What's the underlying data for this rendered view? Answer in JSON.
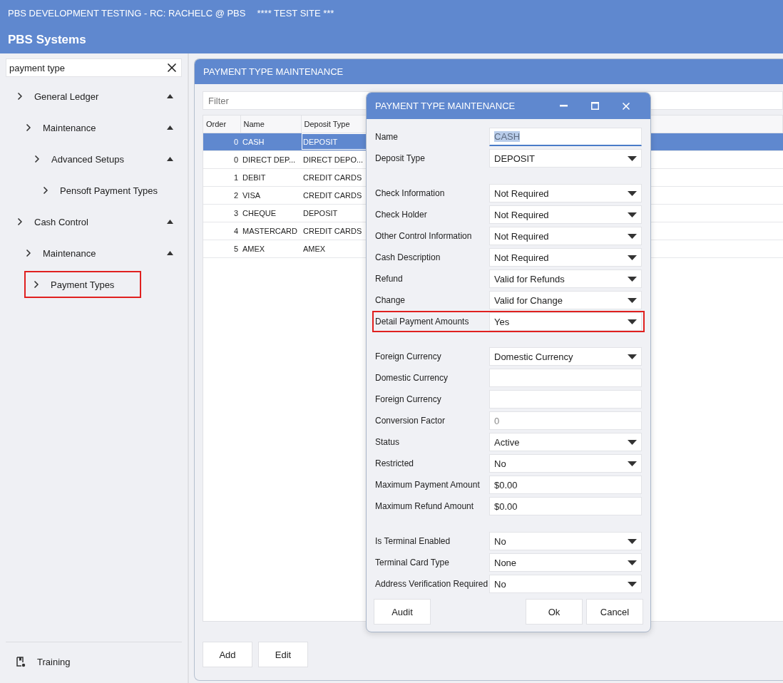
{
  "app": {
    "title": "PBS DEVELOPMENT TESTING - RC: RACHELC @ PBS",
    "site_note": "**** TEST SITE ***",
    "name": "PBS Systems"
  },
  "sidebar": {
    "search": {
      "value": "payment type"
    },
    "tree": [
      {
        "label": "General Ledger",
        "expanded": true,
        "highlighted": false,
        "children": [
          {
            "label": "Maintenance",
            "expanded": true,
            "highlighted": false,
            "children": [
              {
                "label": "Advanced Setups",
                "expanded": true,
                "highlighted": false,
                "children": [
                  {
                    "label": "Pensoft Payment Types",
                    "highlighted": false
                  }
                ]
              }
            ]
          }
        ]
      },
      {
        "label": "Cash Control",
        "expanded": true,
        "highlighted": false,
        "children": [
          {
            "label": "Maintenance",
            "expanded": true,
            "highlighted": false,
            "children": [
              {
                "label": "Payment Types",
                "highlighted": true
              }
            ]
          }
        ]
      }
    ],
    "footer_item": {
      "label": "Training"
    }
  },
  "panel": {
    "title": "PAYMENT TYPE MAINTENANCE",
    "filter": {
      "placeholder": "Filter"
    },
    "table": {
      "columns": [
        "Order",
        "Name",
        "Deposit Type"
      ],
      "rows": [
        {
          "order": "0",
          "name": "CASH",
          "deposit_type": "DEPOSIT",
          "selected": true
        },
        {
          "order": "0",
          "name": "DIRECT DEP...",
          "deposit_type": "DIRECT DEPO...",
          "selected": false
        },
        {
          "order": "1",
          "name": "DEBIT",
          "deposit_type": "CREDIT CARDS",
          "selected": false
        },
        {
          "order": "2",
          "name": "VISA",
          "deposit_type": "CREDIT CARDS",
          "selected": false
        },
        {
          "order": "3",
          "name": "CHEQUE",
          "deposit_type": "DEPOSIT",
          "selected": false
        },
        {
          "order": "4",
          "name": "MASTERCARD",
          "deposit_type": "CREDIT CARDS",
          "selected": false
        },
        {
          "order": "5",
          "name": "AMEX",
          "deposit_type": "AMEX",
          "selected": false
        }
      ]
    },
    "buttons": [
      "Add",
      "Edit"
    ]
  },
  "dialog": {
    "title": "PAYMENT TYPE MAINTENANCE",
    "groups": [
      {
        "fields": [
          {
            "label": "Name",
            "kind": "text",
            "value": "CASH",
            "focused": true,
            "highlighted": false
          },
          {
            "label": "Deposit Type",
            "kind": "select",
            "value": "DEPOSIT",
            "focused": false,
            "highlighted": false
          }
        ]
      },
      {
        "fields": [
          {
            "label": "Check Information",
            "kind": "select",
            "value": "Not Required",
            "focused": false,
            "highlighted": false
          },
          {
            "label": "Check Holder",
            "kind": "select",
            "value": "Not Required",
            "focused": false,
            "highlighted": false
          },
          {
            "label": "Other Control Information",
            "kind": "select",
            "value": "Not Required",
            "focused": false,
            "highlighted": false
          },
          {
            "label": "Cash Description",
            "kind": "select",
            "value": "Not Required",
            "focused": false,
            "highlighted": false
          },
          {
            "label": "Refund",
            "kind": "select",
            "value": "Valid for Refunds",
            "focused": false,
            "highlighted": false
          },
          {
            "label": "Change",
            "kind": "select",
            "value": "Valid for Change",
            "focused": false,
            "highlighted": false
          },
          {
            "label": "Detail Payment Amounts",
            "kind": "select",
            "value": "Yes",
            "focused": false,
            "highlighted": true
          }
        ]
      },
      {
        "fields": [
          {
            "label": "Foreign Currency",
            "kind": "select",
            "value": "Domestic Currency",
            "focused": false,
            "highlighted": false
          },
          {
            "label": "Domestic Currency",
            "kind": "text",
            "focused": false,
            "highlighted": false
          },
          {
            "label": "Foreign Currency",
            "kind": "text",
            "focused": false,
            "highlighted": false
          },
          {
            "label": "Conversion Factor",
            "kind": "readonly",
            "value": "0",
            "focused": false,
            "highlighted": false
          },
          {
            "label": "Status",
            "kind": "select",
            "value": "Active",
            "focused": false,
            "highlighted": false
          },
          {
            "label": "Restricted",
            "kind": "select",
            "value": "No",
            "focused": false,
            "highlighted": false
          },
          {
            "label": "Maximum Payment Amount",
            "kind": "text",
            "value": "$0.00",
            "focused": false,
            "highlighted": false
          },
          {
            "label": "Maximum Refund Amount",
            "kind": "text",
            "value": "$0.00",
            "focused": false,
            "highlighted": false
          }
        ]
      },
      {
        "fields": [
          {
            "label": "Is Terminal Enabled",
            "kind": "select",
            "value": "No",
            "focused": false,
            "highlighted": false
          },
          {
            "label": "Terminal Card Type",
            "kind": "select",
            "value": "None",
            "focused": false,
            "highlighted": false
          },
          {
            "label": "Address Verification Required",
            "kind": "select",
            "value": "No",
            "focused": false,
            "highlighted": false
          }
        ]
      }
    ],
    "left_buttons": [
      "Audit"
    ],
    "right_buttons": [
      "Ok",
      "Cancel"
    ]
  }
}
